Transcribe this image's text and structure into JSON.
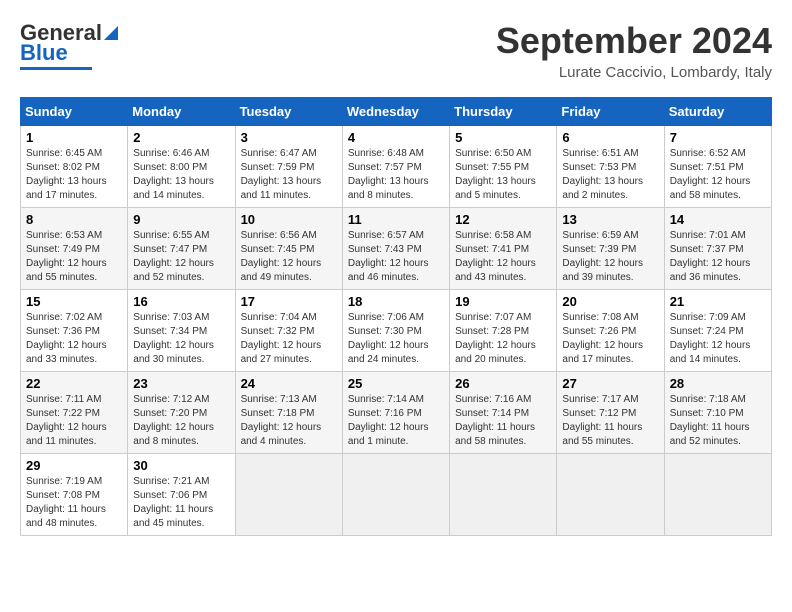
{
  "logo": {
    "line1": "General",
    "line2": "Blue"
  },
  "title": "September 2024",
  "subtitle": "Lurate Caccivio, Lombardy, Italy",
  "weekdays": [
    "Sunday",
    "Monday",
    "Tuesday",
    "Wednesday",
    "Thursday",
    "Friday",
    "Saturday"
  ],
  "weeks": [
    [
      {
        "day": "1",
        "info": "Sunrise: 6:45 AM\nSunset: 8:02 PM\nDaylight: 13 hours and 17 minutes."
      },
      {
        "day": "2",
        "info": "Sunrise: 6:46 AM\nSunset: 8:00 PM\nDaylight: 13 hours and 14 minutes."
      },
      {
        "day": "3",
        "info": "Sunrise: 6:47 AM\nSunset: 7:59 PM\nDaylight: 13 hours and 11 minutes."
      },
      {
        "day": "4",
        "info": "Sunrise: 6:48 AM\nSunset: 7:57 PM\nDaylight: 13 hours and 8 minutes."
      },
      {
        "day": "5",
        "info": "Sunrise: 6:50 AM\nSunset: 7:55 PM\nDaylight: 13 hours and 5 minutes."
      },
      {
        "day": "6",
        "info": "Sunrise: 6:51 AM\nSunset: 7:53 PM\nDaylight: 13 hours and 2 minutes."
      },
      {
        "day": "7",
        "info": "Sunrise: 6:52 AM\nSunset: 7:51 PM\nDaylight: 12 hours and 58 minutes."
      }
    ],
    [
      {
        "day": "8",
        "info": "Sunrise: 6:53 AM\nSunset: 7:49 PM\nDaylight: 12 hours and 55 minutes."
      },
      {
        "day": "9",
        "info": "Sunrise: 6:55 AM\nSunset: 7:47 PM\nDaylight: 12 hours and 52 minutes."
      },
      {
        "day": "10",
        "info": "Sunrise: 6:56 AM\nSunset: 7:45 PM\nDaylight: 12 hours and 49 minutes."
      },
      {
        "day": "11",
        "info": "Sunrise: 6:57 AM\nSunset: 7:43 PM\nDaylight: 12 hours and 46 minutes."
      },
      {
        "day": "12",
        "info": "Sunrise: 6:58 AM\nSunset: 7:41 PM\nDaylight: 12 hours and 43 minutes."
      },
      {
        "day": "13",
        "info": "Sunrise: 6:59 AM\nSunset: 7:39 PM\nDaylight: 12 hours and 39 minutes."
      },
      {
        "day": "14",
        "info": "Sunrise: 7:01 AM\nSunset: 7:37 PM\nDaylight: 12 hours and 36 minutes."
      }
    ],
    [
      {
        "day": "15",
        "info": "Sunrise: 7:02 AM\nSunset: 7:36 PM\nDaylight: 12 hours and 33 minutes."
      },
      {
        "day": "16",
        "info": "Sunrise: 7:03 AM\nSunset: 7:34 PM\nDaylight: 12 hours and 30 minutes."
      },
      {
        "day": "17",
        "info": "Sunrise: 7:04 AM\nSunset: 7:32 PM\nDaylight: 12 hours and 27 minutes."
      },
      {
        "day": "18",
        "info": "Sunrise: 7:06 AM\nSunset: 7:30 PM\nDaylight: 12 hours and 24 minutes."
      },
      {
        "day": "19",
        "info": "Sunrise: 7:07 AM\nSunset: 7:28 PM\nDaylight: 12 hours and 20 minutes."
      },
      {
        "day": "20",
        "info": "Sunrise: 7:08 AM\nSunset: 7:26 PM\nDaylight: 12 hours and 17 minutes."
      },
      {
        "day": "21",
        "info": "Sunrise: 7:09 AM\nSunset: 7:24 PM\nDaylight: 12 hours and 14 minutes."
      }
    ],
    [
      {
        "day": "22",
        "info": "Sunrise: 7:11 AM\nSunset: 7:22 PM\nDaylight: 12 hours and 11 minutes."
      },
      {
        "day": "23",
        "info": "Sunrise: 7:12 AM\nSunset: 7:20 PM\nDaylight: 12 hours and 8 minutes."
      },
      {
        "day": "24",
        "info": "Sunrise: 7:13 AM\nSunset: 7:18 PM\nDaylight: 12 hours and 4 minutes."
      },
      {
        "day": "25",
        "info": "Sunrise: 7:14 AM\nSunset: 7:16 PM\nDaylight: 12 hours and 1 minute."
      },
      {
        "day": "26",
        "info": "Sunrise: 7:16 AM\nSunset: 7:14 PM\nDaylight: 11 hours and 58 minutes."
      },
      {
        "day": "27",
        "info": "Sunrise: 7:17 AM\nSunset: 7:12 PM\nDaylight: 11 hours and 55 minutes."
      },
      {
        "day": "28",
        "info": "Sunrise: 7:18 AM\nSunset: 7:10 PM\nDaylight: 11 hours and 52 minutes."
      }
    ],
    [
      {
        "day": "29",
        "info": "Sunrise: 7:19 AM\nSunset: 7:08 PM\nDaylight: 11 hours and 48 minutes."
      },
      {
        "day": "30",
        "info": "Sunrise: 7:21 AM\nSunset: 7:06 PM\nDaylight: 11 hours and 45 minutes."
      },
      {
        "day": "",
        "info": ""
      },
      {
        "day": "",
        "info": ""
      },
      {
        "day": "",
        "info": ""
      },
      {
        "day": "",
        "info": ""
      },
      {
        "day": "",
        "info": ""
      }
    ]
  ]
}
